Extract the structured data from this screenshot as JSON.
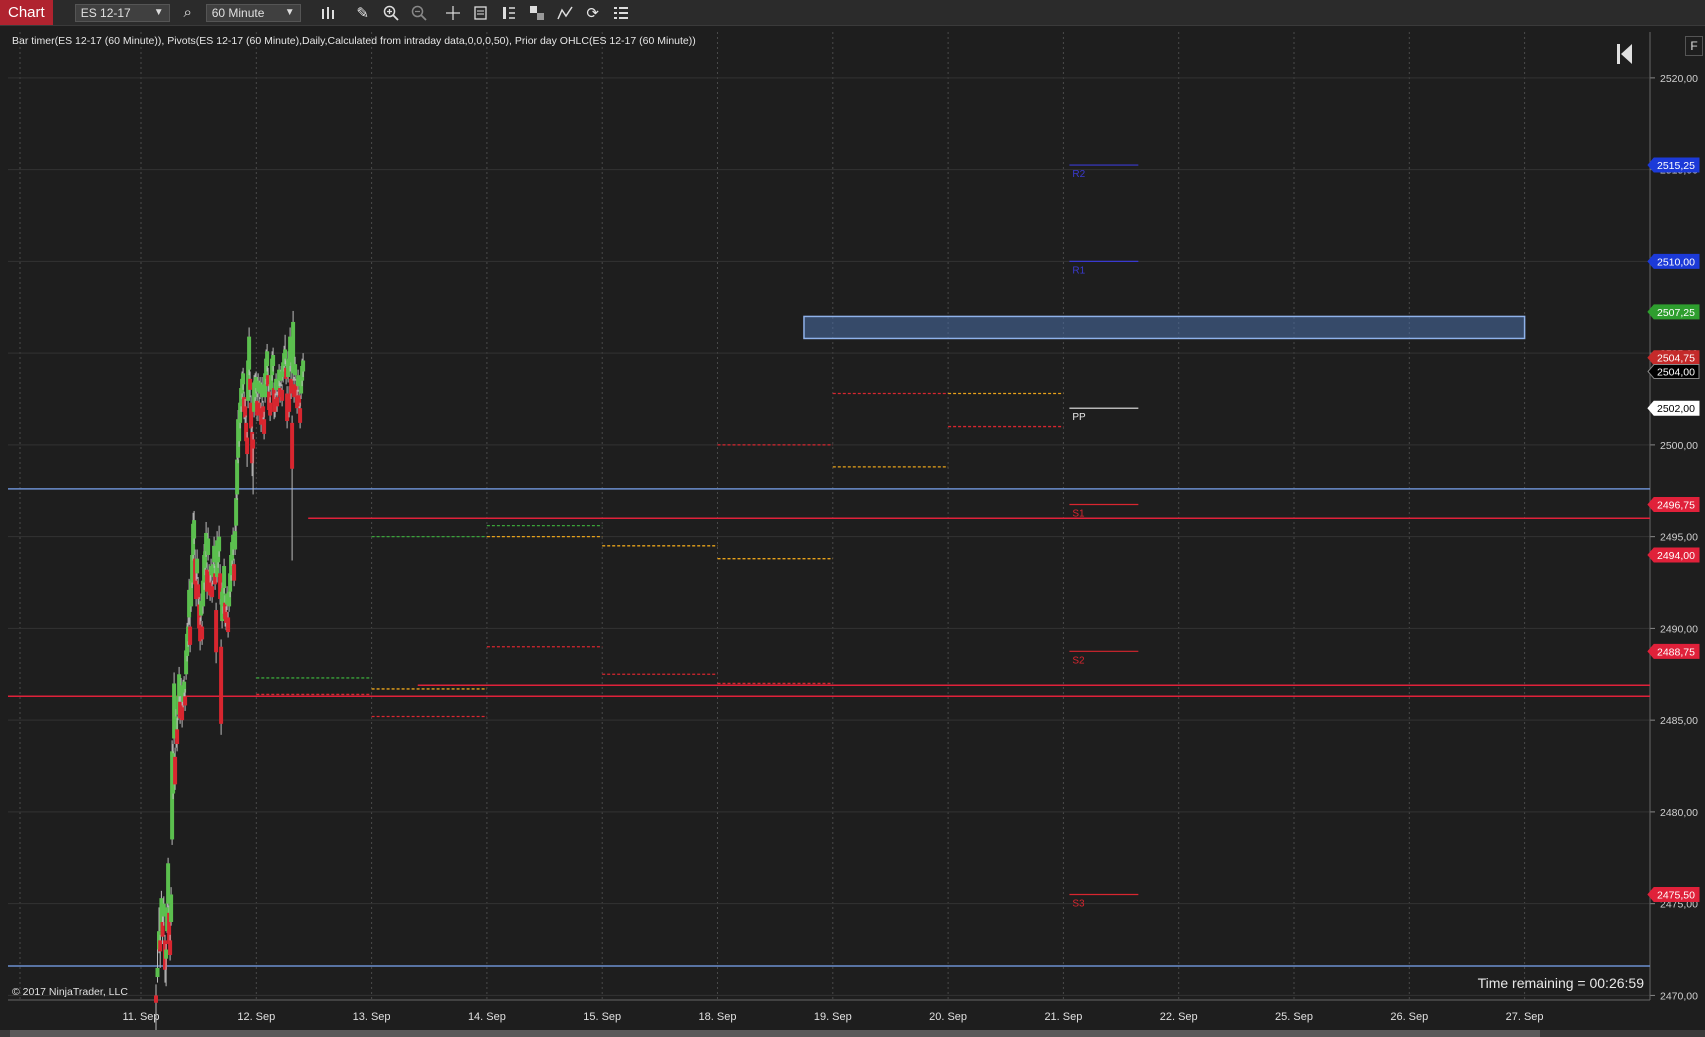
{
  "toolbar": {
    "tab_label": "Chart",
    "instrument": "ES 12-17",
    "interval": "60 Minute",
    "icons": [
      "search-icon",
      "bars-type-icon",
      "pencil-icon",
      "zoom-in-icon",
      "zoom-out-icon",
      "crosshair-icon",
      "data-box-icon",
      "chart-style-icon",
      "drawing-tools-icon",
      "indicators-icon",
      "reload-icon",
      "properties-icon"
    ]
  },
  "indicator_label": "Bar timer(ES 12-17 (60 Minute)), Pivots(ES 12-17 (60 Minute),Daily,Calculated from intraday data,0,0,0,50), Prior day OHLC(ES 12-17 (60 Minute))",
  "copyright": "© 2017 NinjaTrader, LLC",
  "time_remaining": "Time remaining = 00:26:59",
  "f_button": "F",
  "colors": {
    "up": "#5bbf4e",
    "down": "#d8262f",
    "blue_line": "#6b8fcf",
    "red_line": "#e0213a",
    "rect_fill": "#4a6fa8",
    "r_level": "#3a3ad0",
    "s_level": "#d8262f",
    "pivot": "#e8e8e8",
    "orange": "#e8a21a",
    "green_dash": "#3aa33a"
  },
  "chart_data": {
    "type": "candlestick",
    "x_ticks": [
      "11. Sep",
      "12. Sep",
      "13. Sep",
      "14. Sep",
      "15. Sep",
      "18. Sep",
      "19. Sep",
      "20. Sep",
      "21. Sep",
      "22. Sep",
      "25. Sep",
      "26. Sep",
      "27. Sep"
    ],
    "y_ticks": [
      "2520,00",
      "2515,00",
      "2510,00",
      "2505,00",
      "2500,00",
      "2495,00",
      "2490,00",
      "2485,00",
      "2480,00",
      "2475,00",
      "2470,00"
    ],
    "ylim": [
      2469.75,
      2522.5
    ],
    "grid": true,
    "price_labels": [
      {
        "text": "2515,25",
        "value": 2515.25,
        "color": "#1c3ad8"
      },
      {
        "text": "2510,00",
        "value": 2510.0,
        "color": "#1c3ad8"
      },
      {
        "text": "2507,25",
        "value": 2507.25,
        "color": "#2e9e2e"
      },
      {
        "text": "2504,75",
        "value": 2504.75,
        "color": "#c42a2a"
      },
      {
        "text": "2504,00",
        "value": 2504.0,
        "color": "#000000"
      },
      {
        "text": "2502,00",
        "value": 2502.0,
        "color": "#ffffff"
      },
      {
        "text": "2496,75",
        "value": 2496.75,
        "color": "#e0213a"
      },
      {
        "text": "2494,00",
        "value": 2494.0,
        "color": "#e0213a"
      },
      {
        "text": "2488,75",
        "value": 2488.75,
        "color": "#e0213a"
      },
      {
        "text": "2475,50",
        "value": 2475.5,
        "color": "#e0213a"
      }
    ],
    "pivot_labels": [
      {
        "text": "R2",
        "value": 2515.25
      },
      {
        "text": "R1",
        "value": 2510.0
      },
      {
        "text": "PP",
        "value": 2502.0
      },
      {
        "text": "S1",
        "value": 2496.75
      },
      {
        "text": "S2",
        "value": 2488.75
      },
      {
        "text": "S3",
        "value": 2475.5
      }
    ],
    "horizontal_lines": [
      {
        "value": 2497.6,
        "x_start": 0,
        "color": "blue"
      },
      {
        "value": 2471.6,
        "x_start": 0,
        "color": "blue"
      },
      {
        "value": 2496.0,
        "x_start": 1.45,
        "color": "red"
      },
      {
        "value": 2486.9,
        "x_start": 2.4,
        "color": "red"
      },
      {
        "value": 2486.3,
        "x_start": 0,
        "color": "red"
      }
    ],
    "resistance_zone": {
      "x_start": 5.75,
      "x_end": 12.0,
      "top": 2507.0,
      "bottom": 2505.8
    },
    "candles": [
      [
        10.0,
        -0.4,
        0.6,
        -1.7,
        2470.0
      ],
      [
        1.5,
        0.5,
        1.2,
        -0.3,
        2471.0
      ],
      [
        1.5,
        1.0,
        1.3,
        -0.2,
        2472.5
      ],
      [
        1.2,
        -0.6,
        0.3,
        -0.9,
        2473.0
      ],
      [
        1.2,
        1.8,
        0.4,
        -0.1,
        2473.5
      ],
      [
        1.2,
        -0.8,
        0.5,
        -0.4,
        2474.0
      ],
      [
        1.2,
        0.7,
        0.4,
        -0.5,
        2474.3
      ],
      [
        1.2,
        -1.6,
        0.3,
        -0.7,
        2473.0
      ],
      [
        1.1,
        0.5,
        0.3,
        -1.5,
        2472.0
      ],
      [
        1.0,
        1.3,
        0.4,
        -0.1,
        2473.5
      ],
      [
        1.0,
        2.2,
        0.3,
        -0.2,
        2475.0
      ],
      [
        1.0,
        -1.7,
        0.4,
        -0.3,
        2474.5
      ],
      [
        1.0,
        -0.8,
        0.3,
        -0.3,
        2473.0
      ],
      [
        1.0,
        1.5,
        0.4,
        -0.2,
        2474.0
      ],
      [
        1.0,
        4.8,
        0.6,
        -0.3,
        2478.5
      ],
      [
        1.0,
        2.2,
        0.5,
        -0.3,
        2481.0
      ],
      [
        1.0,
        3.0,
        0.6,
        -0.3,
        2484.0
      ],
      [
        1.0,
        -1.5,
        0.5,
        -0.3,
        2483.0
      ],
      [
        1.0,
        1.2,
        0.4,
        -0.5,
        2484.0
      ],
      [
        1.0,
        -0.8,
        0.6,
        -0.4,
        2484.5
      ],
      [
        1.0,
        1.0,
        0.5,
        -0.3,
        2485.3
      ],
      [
        1.0,
        1.2,
        0.4,
        -0.3,
        2486.3
      ],
      [
        1.0,
        -0.9,
        0.5,
        -0.3,
        2486.0
      ],
      [
        1.0,
        0.6,
        0.4,
        -0.3,
        2486.3
      ],
      [
        1.0,
        -0.8,
        0.4,
        -0.4,
        2485.8
      ],
      [
        1.0,
        0.7,
        0.5,
        -0.3,
        2486.0
      ],
      [
        1.0,
        0.6,
        0.3,
        -0.3,
        2486.5
      ],
      [
        1.0,
        -0.5,
        0.4,
        -0.3,
        2486.3
      ],
      [
        1.0,
        1.3,
        0.5,
        -0.3,
        2487.5
      ],
      [
        1.0,
        1.2,
        0.6,
        -0.3,
        2488.5
      ],
      [
        1.0,
        0.8,
        0.5,
        -0.3,
        2489.3
      ],
      [
        1.0,
        1.5,
        0.6,
        -0.4,
        2490.6
      ],
      [
        1.0,
        -1.0,
        0.5,
        -0.4,
        2490.1
      ],
      [
        1.0,
        1.4,
        0.5,
        -0.3,
        2491.2
      ],
      [
        1.0,
        1.5,
        0.6,
        -0.3,
        2492.5
      ],
      [
        1.0,
        1.7,
        0.6,
        -0.3,
        2494.0
      ],
      [
        1.0,
        1.0,
        0.5,
        -0.3,
        2494.9
      ],
      [
        1.0,
        -1.4,
        0.5,
        -0.4,
        2493.8
      ],
      [
        1.0,
        -1.0,
        0.4,
        -0.4,
        2492.6
      ],
      [
        1.0,
        0.8,
        0.5,
        -0.3,
        2493.0
      ],
      [
        1.0,
        -0.8,
        0.4,
        -0.3,
        2492.4
      ],
      [
        1.0,
        -1.3,
        0.4,
        -0.4,
        2491.3
      ],
      [
        1.0,
        -0.9,
        0.4,
        -0.5,
        2490.2
      ],
      [
        1.0,
        0.8,
        0.4,
        -0.3,
        2490.7
      ],
      [
        1.0,
        -0.7,
        0.3,
        -0.3,
        2490.1
      ],
      [
        1.0,
        1.4,
        0.5,
        -0.4,
        2491.2
      ],
      [
        1.0,
        1.5,
        0.6,
        -0.4,
        2492.5
      ],
      [
        1.0,
        0.9,
        0.5,
        -0.4,
        2493.3
      ],
      [
        1.0,
        1.0,
        0.6,
        -0.3,
        2494.2
      ],
      [
        1.0,
        -1.2,
        0.4,
        -0.4,
        2493.2
      ],
      [
        1.0,
        0.9,
        0.6,
        -0.3,
        2494.0
      ],
      [
        1.0,
        -0.9,
        0.4,
        -0.4,
        2493.1
      ],
      [
        1.0,
        -0.7,
        0.4,
        -0.3,
        2492.5
      ],
      [
        1.0,
        0.5,
        0.4,
        -0.3,
        2492.9
      ],
      [
        1.0,
        -0.6,
        0.3,
        -0.3,
        2492.3
      ],
      [
        1.0,
        0.7,
        0.4,
        -0.4,
        2492.8
      ],
      [
        1.0,
        0.9,
        0.5,
        -0.3,
        2493.6
      ],
      [
        1.0,
        -0.6,
        0.4,
        -0.3,
        2493.0
      ],
      [
        1.0,
        -2.3,
        0.4,
        -0.6,
        2491.0
      ],
      [
        1.0,
        2.0,
        0.5,
        -0.3,
        2492.8
      ],
      [
        1.0,
        0.9,
        0.5,
        -0.3,
        2493.6
      ],
      [
        1.0,
        0.8,
        0.6,
        -0.3,
        2494.2
      ],
      [
        1.0,
        -1.4,
        0.5,
        -0.3,
        2493.0
      ],
      [
        1.0,
        -4.2,
        0.4,
        -0.6,
        2489.0
      ],
      [
        1.0,
        1.6,
        0.5,
        -0.4,
        2490.4
      ],
      [
        1.0,
        1.0,
        0.5,
        -0.4,
        2491.2
      ],
      [
        1.0,
        1.2,
        0.4,
        -0.3,
        2492.2
      ],
      [
        1.0,
        -0.9,
        0.4,
        -0.4,
        2491.4
      ],
      [
        1.0,
        -0.6,
        0.3,
        -0.4,
        2490.9
      ],
      [
        1.0,
        0.6,
        0.4,
        -0.3,
        2491.3
      ],
      [
        1.0,
        -0.8,
        0.3,
        -0.3,
        2490.6
      ],
      [
        1.0,
        0.8,
        0.4,
        -0.3,
        2491.2
      ],
      [
        1.0,
        1.0,
        0.4,
        -0.3,
        2492.0
      ],
      [
        1.0,
        1.1,
        0.5,
        -0.3,
        2492.9
      ],
      [
        1.0,
        1.0,
        0.4,
        -0.3,
        2493.7
      ],
      [
        1.0,
        0.8,
        0.4,
        -0.3,
        2494.3
      ],
      [
        1.0,
        -0.9,
        0.3,
        -0.3,
        2493.5
      ],
      [
        1.0,
        1.0,
        0.4,
        -0.3,
        2494.3
      ],
      [
        1.0,
        1.5,
        0.5,
        -0.3,
        2495.6
      ],
      [
        1.0,
        1.9,
        0.4,
        -0.3,
        2497.3
      ],
      [
        1.0,
        2.1,
        0.5,
        -0.3,
        2499.3
      ],
      [
        1.0,
        1.0,
        0.4,
        -0.3,
        2500.2
      ],
      [
        1.0,
        1.1,
        0.4,
        -0.3,
        2501.2
      ],
      [
        1.0,
        1.0,
        0.4,
        -0.3,
        2502.1
      ],
      [
        1.0,
        0.8,
        0.4,
        -0.3,
        2502.8
      ],
      [
        1.0,
        0.6,
        0.3,
        -0.3,
        2503.3
      ],
      [
        1.0,
        -0.8,
        0.3,
        -0.4,
        2502.6
      ],
      [
        1.0,
        -0.6,
        0.4,
        -0.4,
        2502.1
      ],
      [
        1.0,
        -1.0,
        0.4,
        -0.6,
        2501.2
      ],
      [
        1.0,
        -0.9,
        0.3,
        -0.7,
        2500.4
      ],
      [
        1.0,
        2.2,
        0.5,
        -0.4,
        2502.4
      ],
      [
        1.0,
        1.8,
        0.5,
        -0.3,
        2504.1
      ],
      [
        1.0,
        -0.6,
        0.4,
        -0.4,
        2503.6
      ],
      [
        1.0,
        -1.4,
        0.4,
        -0.4,
        2502.3
      ],
      [
        1.0,
        -1.7,
        0.3,
        -0.7,
        2500.7
      ],
      [
        1.0,
        -0.5,
        0.3,
        -2.5,
        2500.3
      ],
      [
        1.0,
        1.6,
        0.4,
        -0.3,
        2501.8
      ],
      [
        1.0,
        0.9,
        0.4,
        -0.3,
        2502.6
      ],
      [
        1.0,
        0.6,
        0.3,
        -0.3,
        2503.1
      ],
      [
        1.0,
        -0.8,
        0.4,
        -0.3,
        2502.4
      ],
      [
        1.0,
        0.6,
        0.4,
        -0.3,
        2502.9
      ],
      [
        1.0,
        -0.7,
        0.3,
        -0.3,
        2502.3
      ],
      [
        1.0,
        0.6,
        0.3,
        -0.3,
        2502.8
      ],
      [
        1.0,
        -0.9,
        0.3,
        -0.4,
        2502.0
      ],
      [
        1.0,
        0.7,
        0.4,
        -0.3,
        2502.6
      ],
      [
        1.0,
        -0.6,
        0.3,
        -0.3,
        2502.1
      ],
      [
        1.0,
        -0.8,
        0.4,
        -0.3,
        2501.4
      ],
      [
        1.0,
        1.3,
        0.4,
        -0.3,
        2502.6
      ],
      [
        1.0,
        1.1,
        0.5,
        -0.3,
        2503.6
      ],
      [
        1.0,
        0.8,
        0.4,
        -0.3,
        2504.3
      ],
      [
        1.0,
        -0.6,
        0.4,
        -0.3,
        2503.8
      ],
      [
        1.0,
        -1.0,
        0.4,
        -0.3,
        2502.9
      ],
      [
        1.0,
        -0.7,
        0.3,
        -0.3,
        2502.3
      ],
      [
        1.0,
        0.8,
        0.4,
        -0.3,
        2503.0
      ],
      [
        1.0,
        0.9,
        0.4,
        -0.3,
        2503.8
      ],
      [
        1.0,
        0.6,
        0.4,
        -0.3,
        2504.3
      ],
      [
        1.0,
        -1.3,
        0.3,
        -0.4,
        2503.1
      ],
      [
        1.0,
        -0.7,
        0.3,
        -0.3,
        2502.5
      ],
      [
        1.0,
        0.6,
        0.3,
        -0.3,
        2503.0
      ],
      [
        1.0,
        -0.5,
        0.3,
        -0.3,
        2502.6
      ],
      [
        1.0,
        0.5,
        0.3,
        -0.3,
        2503.0
      ],
      [
        1.0,
        0.6,
        0.3,
        -0.3,
        2503.5
      ],
      [
        1.0,
        -0.5,
        0.3,
        -0.3,
        2503.1
      ],
      [
        1.0,
        0.5,
        0.3,
        -0.3,
        2503.5
      ],
      [
        1.0,
        -0.6,
        0.3,
        -0.3,
        2503.0
      ],
      [
        1.0,
        0.8,
        0.4,
        -0.3,
        2503.7
      ],
      [
        1.0,
        0.7,
        0.4,
        -0.3,
        2504.3
      ],
      [
        1.0,
        0.5,
        0.8,
        -0.3,
        2504.7
      ],
      [
        1.0,
        -0.6,
        0.4,
        -0.3,
        2504.2
      ],
      [
        1.0,
        -1.5,
        0.4,
        -0.4,
        2502.8
      ],
      [
        1.0,
        1.0,
        0.4,
        -0.3,
        2503.7
      ],
      [
        1.0,
        -1.0,
        0.4,
        -0.3,
        2502.8
      ],
      [
        1.0,
        1.6,
        0.5,
        -0.3,
        2504.3
      ],
      [
        1.0,
        -0.8,
        0.9,
        -0.3,
        2503.6
      ],
      [
        1.0,
        -2.5,
        0.4,
        -5.0,
        2501.2
      ],
      [
        1.0,
        2.8,
        0.6,
        -0.4,
        2503.9
      ],
      [
        1.0,
        -0.7,
        0.4,
        -0.3,
        2503.3
      ],
      [
        1.0,
        0.6,
        0.4,
        -0.3,
        2503.8
      ],
      [
        1.0,
        -0.6,
        0.3,
        -0.3,
        2503.3
      ],
      [
        1.0,
        -0.7,
        0.3,
        -0.3,
        2502.7
      ],
      [
        1.0,
        0.6,
        0.3,
        -0.3,
        2503.2
      ],
      [
        1.0,
        -0.6,
        0.3,
        -0.3,
        2502.7
      ],
      [
        1.0,
        -0.8,
        0.3,
        -0.3,
        2502.0
      ],
      [
        1.0,
        0.9,
        0.4,
        -0.3,
        2502.8
      ],
      [
        1.0,
        0.8,
        0.4,
        -0.3,
        2503.5
      ],
      [
        1.0,
        0.6,
        0.4,
        -0.3,
        2504.0
      ]
    ]
  }
}
